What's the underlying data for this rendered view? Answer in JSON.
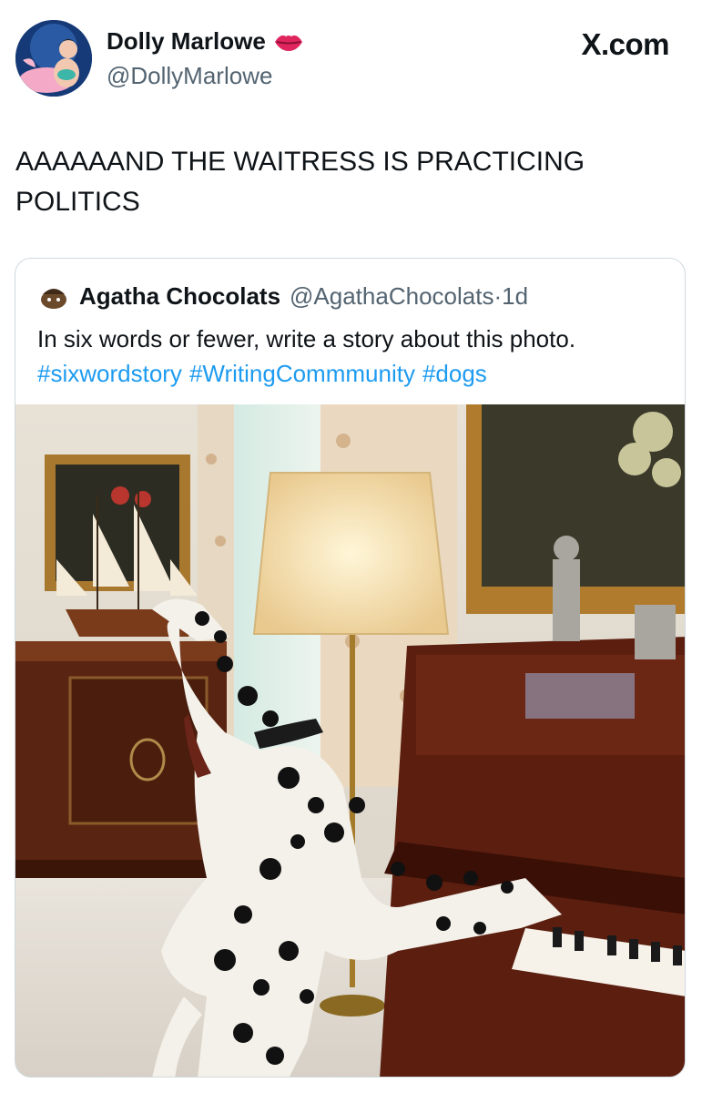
{
  "author": {
    "display_name": "Dolly Marlowe",
    "handle": "@DollyMarlowe",
    "badge_icon": "lips-kiss-icon"
  },
  "site_label": "X.com",
  "tweet": {
    "text": "AAAAAAND THE WAITRESS IS PRACTICING POLITICS"
  },
  "quote": {
    "author_name": "Agatha Chocolats",
    "handle": "@AgathaChocolats",
    "separator": "·",
    "time": "1d",
    "text": "In six words or fewer, write a story about this photo.",
    "hashtags": [
      "#sixwordstory",
      "#WritingCommmunity",
      "#dogs"
    ],
    "photo_icon": "dalmatian-playing-piano-photo"
  },
  "colors": {
    "link": "#1d9bf0",
    "secondary_text": "#536471",
    "border": "#cfd9de"
  }
}
